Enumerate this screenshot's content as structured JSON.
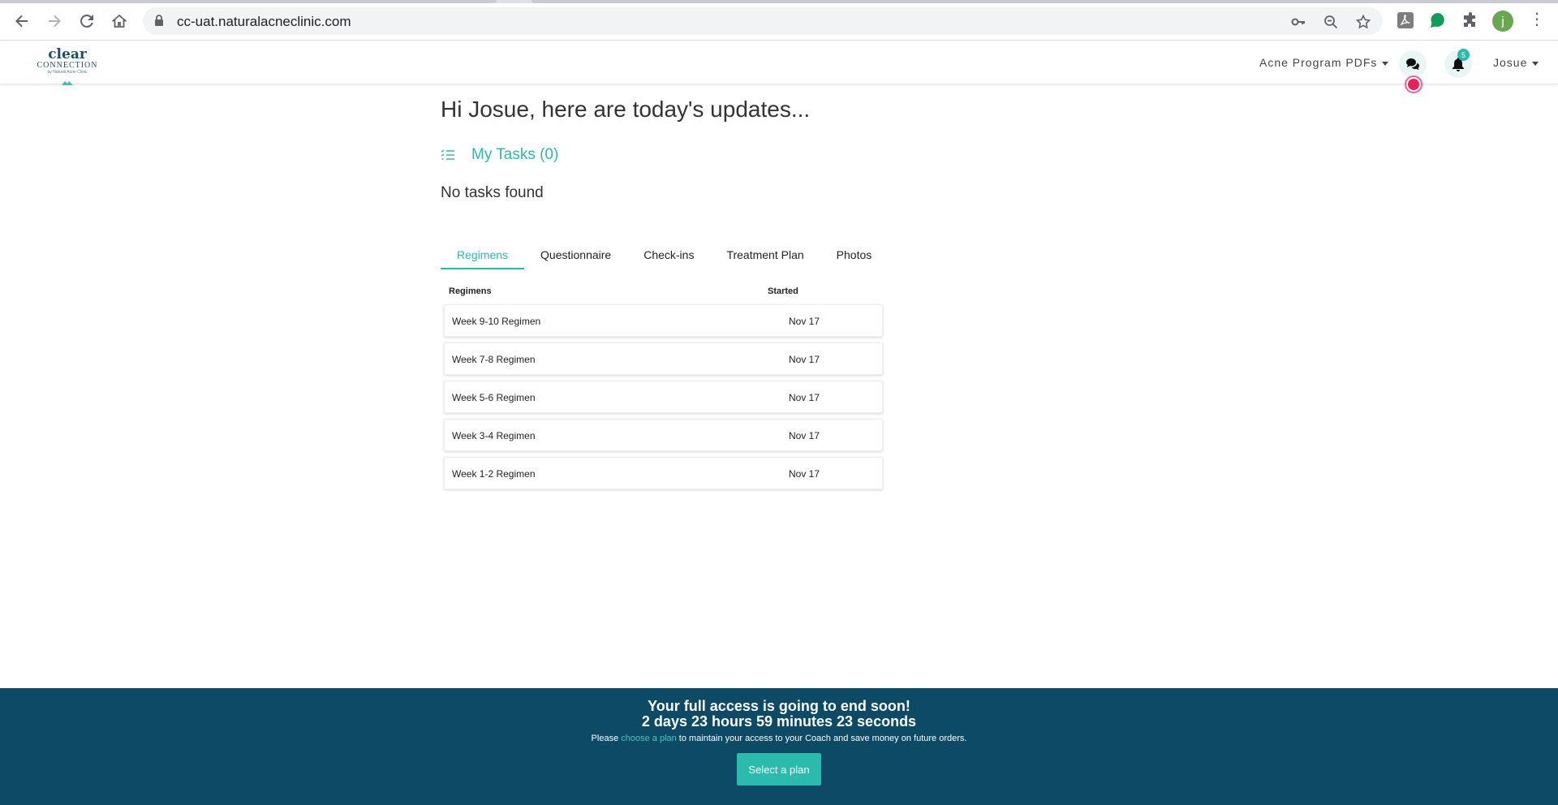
{
  "browser": {
    "url": "cc-uat.naturalacneclinic.com",
    "profile_initial": "j"
  },
  "header": {
    "logo_line1": "clear",
    "logo_line2": "CONNECTION",
    "logo_line3": "by Natural Acne Clinic",
    "pdf_menu": "Acne Program PDFs",
    "notification_count": "5",
    "user_name": "Josue"
  },
  "main": {
    "greeting": "Hi Josue, here are today's updates...",
    "tasks_title": "My Tasks (0)",
    "no_tasks": "No tasks found",
    "tabs": [
      "Regimens",
      "Questionnaire",
      "Check-ins",
      "Treatment Plan",
      "Photos"
    ],
    "active_tab": "Regimens",
    "table": {
      "headers": [
        "Regimens",
        "Started"
      ],
      "rows": [
        {
          "name": "Week 9-10 Regimen",
          "started": "Nov 17"
        },
        {
          "name": "Week 7-8 Regimen",
          "started": "Nov 17"
        },
        {
          "name": "Week 5-6 Regimen",
          "started": "Nov 17"
        },
        {
          "name": "Week 3-4 Regimen",
          "started": "Nov 17"
        },
        {
          "name": "Week 1-2 Regimen",
          "started": "Nov 17"
        }
      ]
    }
  },
  "banner": {
    "headline": "Your full access is going to end soon!",
    "countdown": "2 days 23 hours 59 minutes 23 seconds",
    "text_before": "Please ",
    "link_text": "choose a plan",
    "text_after": " to maintain your access to your Coach and save money on future orders.",
    "button_label": "Select a plan"
  },
  "colors": {
    "accent": "#2bbbad",
    "banner": "#0d4a66",
    "record": "#ec1f5b"
  }
}
